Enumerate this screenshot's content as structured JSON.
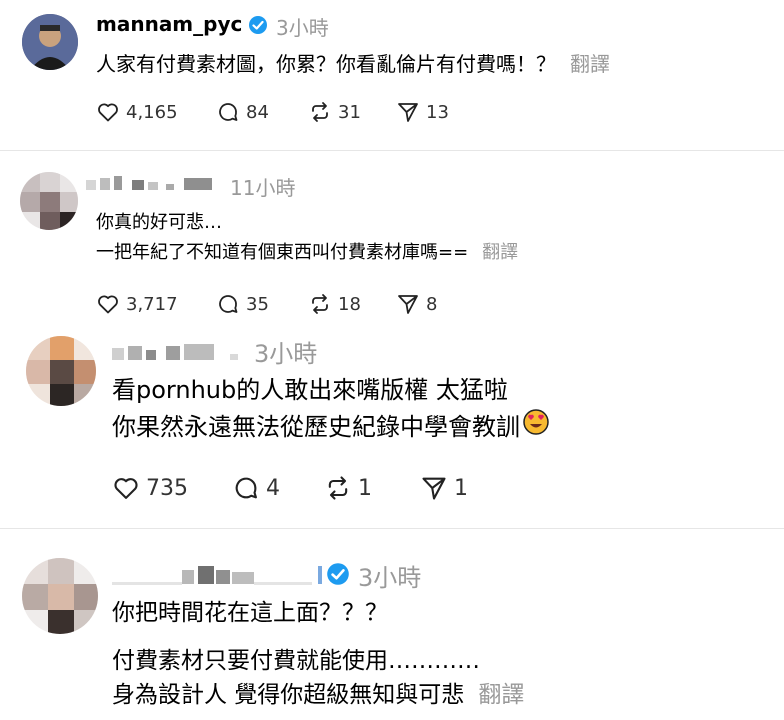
{
  "colors": {
    "verified": "#1d9bf0",
    "time": "#999999",
    "divider": "#e6e6e6"
  },
  "posts": [
    {
      "username": "mannam_pyc",
      "verified": true,
      "time": "3小時",
      "lines": [
        "人家有付費素材圖，你累？你看亂倫片有付費嗎！？"
      ],
      "translate": "翻譯",
      "likes": "4,165",
      "comments": "84",
      "reposts": "31",
      "shares": "13"
    },
    {
      "username": "",
      "verified": false,
      "time": "11小時",
      "lines": [
        "你真的好可悲…",
        "一把年紀了不知道有個東西叫付費素材庫嗎=="
      ],
      "translate": "翻譯",
      "likes": "3,717",
      "comments": "35",
      "reposts": "18",
      "shares": "8"
    },
    {
      "username": "",
      "verified": false,
      "time": "3小時",
      "lines": [
        "看pornhub的人敢出來嘴版權 太猛啦",
        "你果然永遠無法從歷史紀錄中學會教訓"
      ],
      "translate": "",
      "likes": "735",
      "comments": "4",
      "reposts": "1",
      "shares": "1"
    },
    {
      "username": "",
      "verified": true,
      "time": "3小時",
      "lines": [
        "你把時間花在這上面？？？",
        "付費素材只要付費就能使用…………",
        "身為設計人 覺得你超級無知與可悲"
      ],
      "translate": "翻譯"
    }
  ]
}
